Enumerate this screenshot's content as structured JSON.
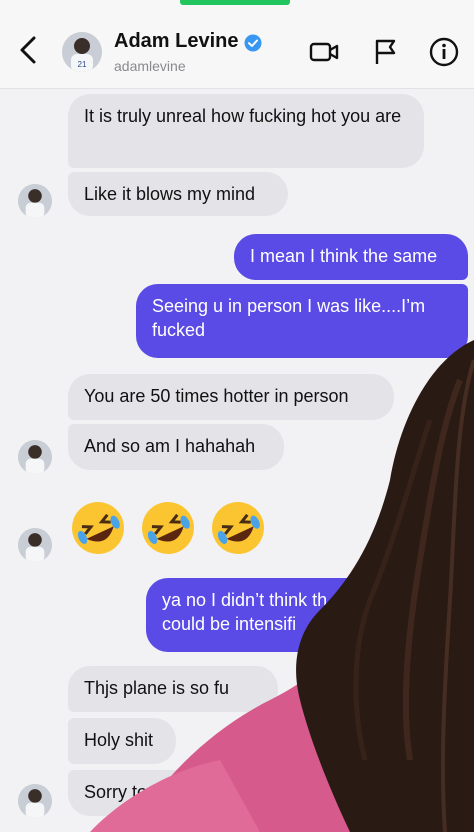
{
  "header": {
    "name": "Adam Levine",
    "handle": "adamlevine",
    "icons": [
      "back-icon",
      "verified-icon",
      "video-call-icon",
      "flag-icon",
      "info-icon"
    ]
  },
  "messages": [
    {
      "dir": "in",
      "text": "It is truly unreal how fucking hot you are"
    },
    {
      "dir": "in",
      "text": "Like it blows my mind"
    },
    {
      "dir": "out",
      "text": "I mean I think the same"
    },
    {
      "dir": "out",
      "text": "Seeing u in person I was like....I’m fucked"
    },
    {
      "dir": "in",
      "text": "You are 50 times hotter in person"
    },
    {
      "dir": "in",
      "text": "And so am I hahahah"
    },
    {
      "dir": "in",
      "emoji": "rolling-on-floor-laughing x3"
    },
    {
      "dir": "out",
      "text": "ya no I didn’t think th could be intensifi"
    },
    {
      "dir": "in",
      "text": "Thjs plane is so fu"
    },
    {
      "dir": "in",
      "text": "Holy shit"
    },
    {
      "dir": "in",
      "text": "Sorry to c"
    }
  ],
  "colors": {
    "outgoing": "#5b4be6",
    "incoming": "#e4e4e8",
    "verified": "#3897f0"
  }
}
